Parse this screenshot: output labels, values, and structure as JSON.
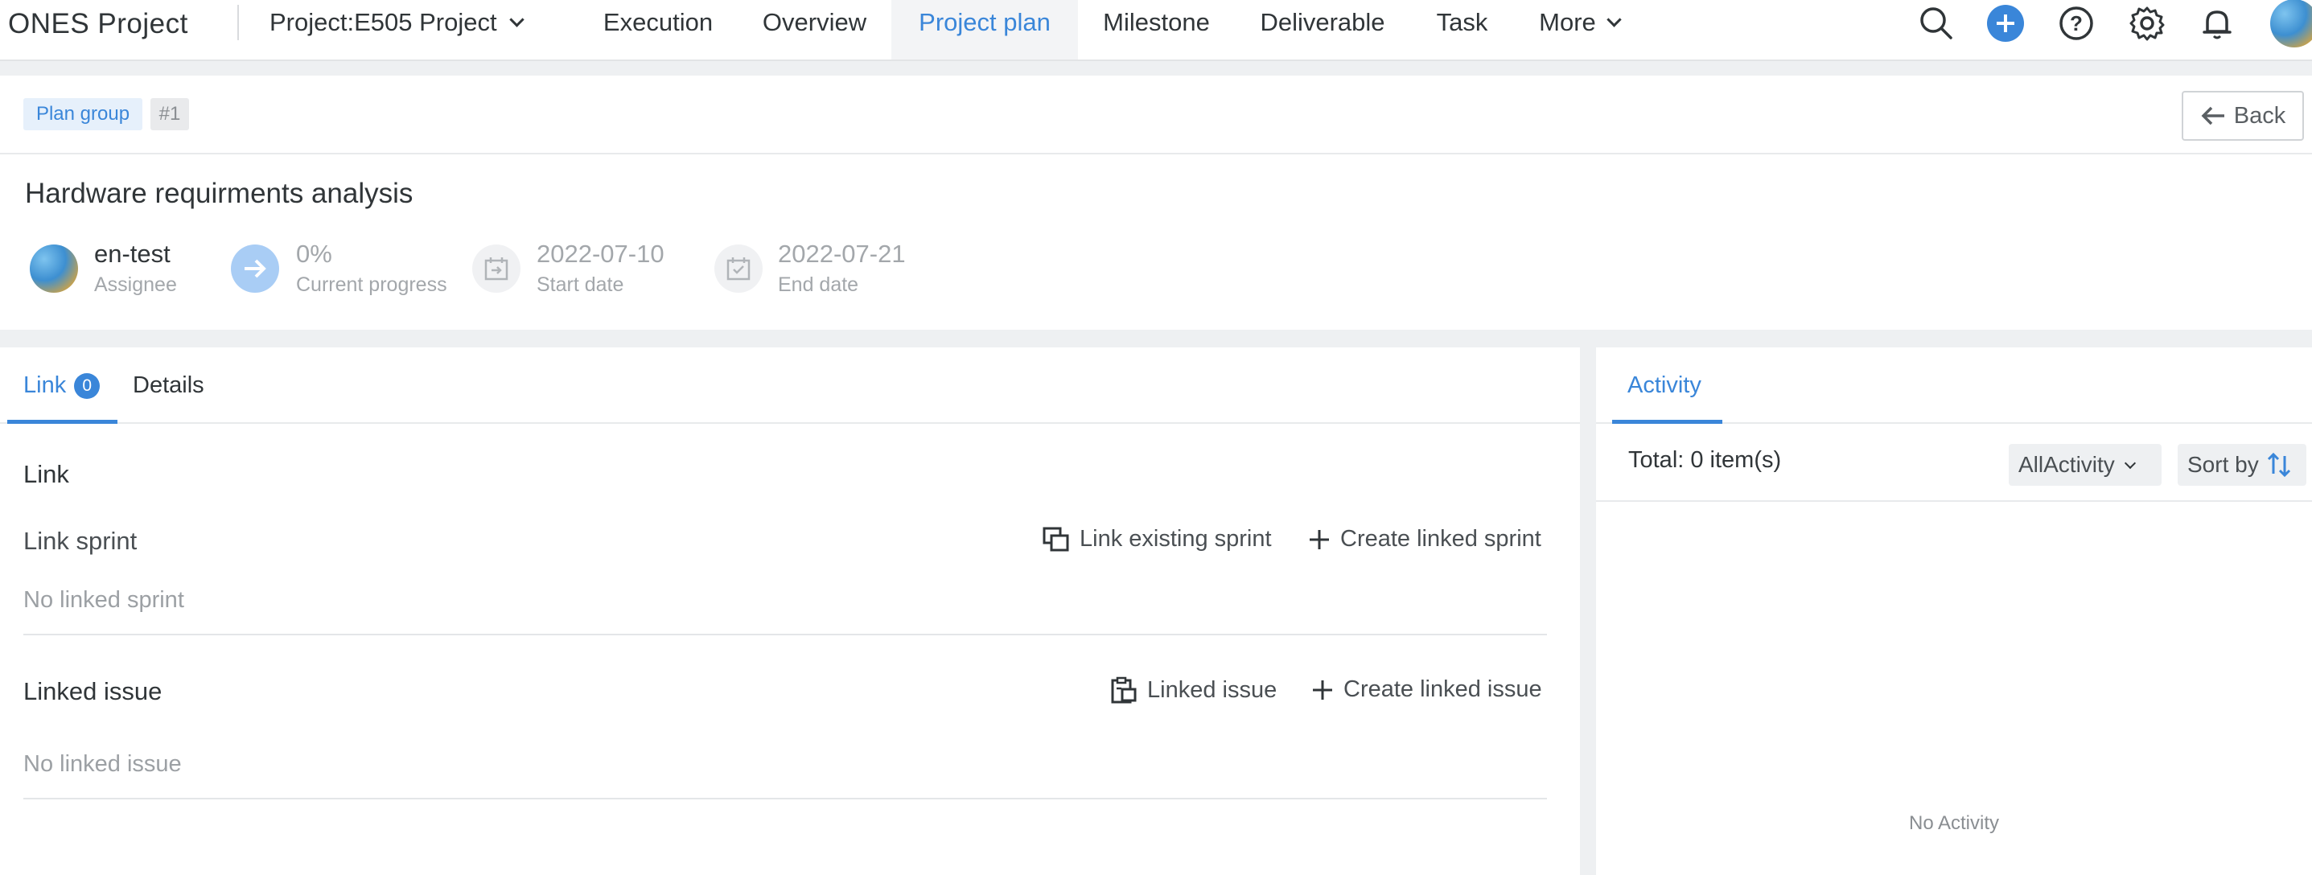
{
  "header": {
    "brand": "ONES Project",
    "project_selector": "Project:E505 Project",
    "nav": [
      "Execution",
      "Overview",
      "Project plan",
      "Milestone",
      "Deliverable",
      "Task",
      "More"
    ],
    "active_nav": "Project plan"
  },
  "breadcrumb": {
    "type_tag": "Plan group",
    "id_tag": "#1"
  },
  "back_label": "Back",
  "item": {
    "title": "Hardware requirments analysis",
    "assignee": {
      "value": "en-test",
      "label": "Assignee"
    },
    "progress": {
      "value": "0%",
      "label": "Current progress"
    },
    "start": {
      "value": "2022-07-10",
      "label": "Start date"
    },
    "end": {
      "value": "2022-07-21",
      "label": "End date"
    }
  },
  "left_panel": {
    "tabs": [
      {
        "label": "Link",
        "count": "0"
      },
      {
        "label": "Details"
      }
    ],
    "section_title": "Link",
    "sprint": {
      "label": "Link sprint",
      "link_existing": "Link existing sprint",
      "create_linked": "Create linked sprint",
      "empty": "No linked sprint"
    },
    "issue": {
      "label": "Linked issue",
      "link_existing": "Linked issue",
      "create_linked": "Create linked issue",
      "empty": "No linked issue"
    }
  },
  "right_panel": {
    "tab": "Activity",
    "total": "Total: 0 item(s)",
    "filter": "AllActivity",
    "sort": "Sort by",
    "empty": "No Activity"
  },
  "colors": {
    "accent": "#3a86d9",
    "text": "#303538",
    "muted": "#a3a7ab"
  }
}
